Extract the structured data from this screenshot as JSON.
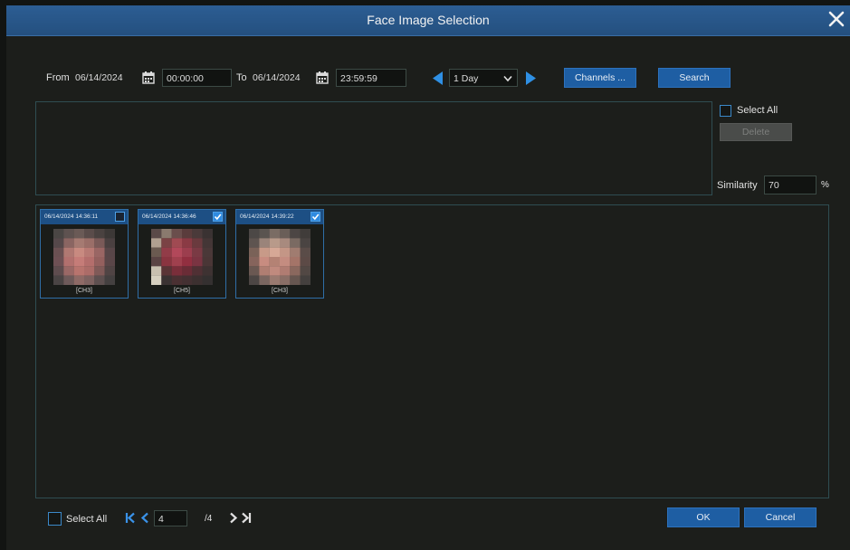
{
  "window": {
    "title": "Face Image Selection"
  },
  "filters": {
    "from_label": "From",
    "from_date": "06/14/2024",
    "from_time": "00:00:00",
    "to_label": "To",
    "to_date": "06/14/2024",
    "to_time": "23:59:59",
    "range": "1 Day",
    "channels_button": "Channels ...",
    "search_button": "Search"
  },
  "side": {
    "select_all_label": "Select All",
    "delete_button": "Delete",
    "similarity_label": "Similarity",
    "similarity_value": "70",
    "similarity_unit": "%"
  },
  "results": [
    {
      "time": "06/14/2024 14:36:11",
      "channel": "[CH3]",
      "checked": false
    },
    {
      "time": "06/14/2024 14:36:46",
      "channel": "[CH5]",
      "checked": true
    },
    {
      "time": "06/14/2024 14:39:22",
      "channel": "[CH3]",
      "checked": true
    }
  ],
  "footer": {
    "select_all_label": "Select All",
    "page_input": "4",
    "page_total": "/4",
    "ok_button": "OK",
    "cancel_button": "Cancel"
  },
  "colors": {
    "accent": "#2f86d5",
    "titlebar": "#2c5d93",
    "button": "#1e5ea3",
    "background": "#1c1e1b"
  }
}
